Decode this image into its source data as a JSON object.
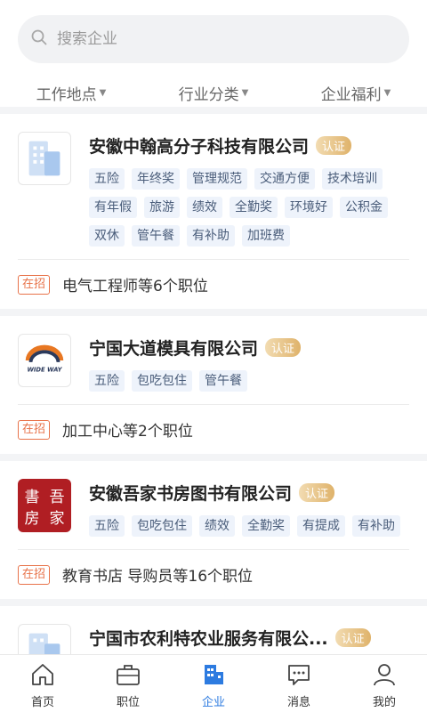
{
  "search": {
    "placeholder": "搜索企业"
  },
  "filters": [
    {
      "label": "工作地点"
    },
    {
      "label": "行业分类"
    },
    {
      "label": "企业福利"
    }
  ],
  "companies": [
    {
      "name": "安徽中翰高分子科技有限公司",
      "badge": "认证",
      "tags": [
        "五险",
        "年终奖",
        "管理规范",
        "交通方便",
        "技术培训",
        "有年假",
        "旅游",
        "绩效",
        "全勤奖",
        "环境好",
        "公积金",
        "双休",
        "管午餐",
        "有补助",
        "加班费"
      ],
      "hiring_label": "在招",
      "jobs": "电气工程师等6个职位"
    },
    {
      "name": "宁国大道模具有限公司",
      "badge": "认证",
      "logo_text": "WIDE WAY",
      "tags": [
        "五险",
        "包吃包住",
        "管午餐"
      ],
      "hiring_label": "在招",
      "jobs": "加工中心等2个职位"
    },
    {
      "name": "安徽吾家书房图书有限公司",
      "badge": "认证",
      "logo_chars": [
        "書",
        "吾",
        "房",
        "家"
      ],
      "tags": [
        "五险",
        "包吃包住",
        "绩效",
        "全勤奖",
        "有提成",
        "有补助"
      ],
      "hiring_label": "在招",
      "jobs": "教育书店 导购员等16个职位"
    },
    {
      "name": "宁国市农利特农业服务有限公...",
      "badge": "认证",
      "tags": [],
      "hiring_label": "",
      "jobs": ""
    }
  ],
  "tabbar": [
    {
      "label": "首页",
      "icon": "home-icon"
    },
    {
      "label": "职位",
      "icon": "briefcase-icon"
    },
    {
      "label": "企业",
      "icon": "building-icon",
      "active": true
    },
    {
      "label": "消息",
      "icon": "message-icon"
    },
    {
      "label": "我的",
      "icon": "user-icon"
    }
  ],
  "colors": {
    "accent": "#2d7be0",
    "badge_gold": "#dfb26a",
    "hiring": "#e8734a",
    "tag_bg": "#eef3fb"
  }
}
